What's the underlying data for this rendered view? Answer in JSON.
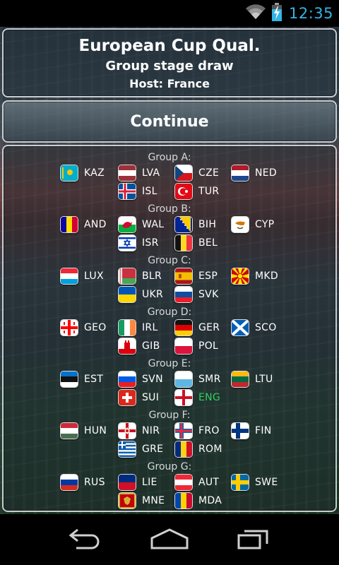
{
  "status": {
    "time": "12:35",
    "icons": [
      "wifi-icon",
      "battery-charging-icon"
    ]
  },
  "header": {
    "title": "European Cup Qual.",
    "subtitle": "Group stage draw",
    "host": "Host: France"
  },
  "continue_label": "Continue",
  "highlight_color": "#2fd25a",
  "groups": [
    {
      "title": "Group A:",
      "teams": [
        "KAZ",
        "LVA",
        "CZE",
        "NED",
        "ISL",
        "TUR"
      ]
    },
    {
      "title": "Group B:",
      "teams": [
        "AND",
        "WAL",
        "BIH",
        "CYP",
        "ISR",
        "BEL"
      ]
    },
    {
      "title": "Group C:",
      "teams": [
        "LUX",
        "BLR",
        "ESP",
        "MKD",
        "UKR",
        "SVK"
      ]
    },
    {
      "title": "Group D:",
      "teams": [
        "GEO",
        "IRL",
        "GER",
        "SCO",
        "GIB",
        "POL"
      ]
    },
    {
      "title": "Group E:",
      "teams": [
        "EST",
        "SVN",
        "SMR",
        "LTU",
        "SUI",
        "ENG"
      ]
    },
    {
      "title": "Group F:",
      "teams": [
        "HUN",
        "NIR",
        "FRO",
        "FIN",
        "GRE",
        "ROM"
      ]
    },
    {
      "title": "Group G:",
      "teams": [
        "RUS",
        "LIE",
        "AUT",
        "SWE",
        "MNE",
        "MDA"
      ]
    }
  ],
  "highlighted_team": "ENG",
  "nav": {
    "buttons": [
      "back-icon",
      "home-icon",
      "recent-apps-icon"
    ]
  }
}
